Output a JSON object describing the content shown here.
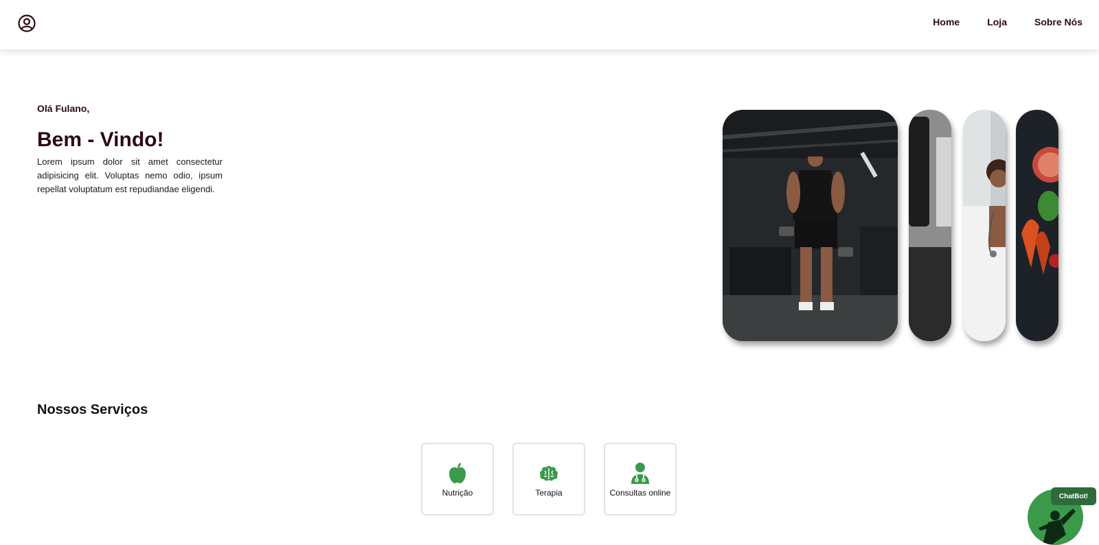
{
  "nav": {
    "user_icon": "user-circle-icon",
    "links": [
      "Home",
      "Loja",
      "Sobre Nós"
    ]
  },
  "hero": {
    "greeting": "Olá Fulano,",
    "title": "Bem - Vindo!",
    "text": "Lorem ipsum dolor sit amet consectetur adipisicing elit. Voluptas nemo odio, ipsum repellat voluptatum est repudiandae eligendi."
  },
  "gallery": {
    "images": [
      "gym-bodybuilder-photo",
      "punching-bag-photo",
      "doctor-photo",
      "vegetables-photo"
    ]
  },
  "services": {
    "title": "Nossos Serviços",
    "items": [
      {
        "label": "Nutrição",
        "icon": "apple-icon"
      },
      {
        "label": "Terapia",
        "icon": "brain-icon"
      },
      {
        "label": "Consultas online",
        "icon": "doctor-icon"
      }
    ],
    "accent": "#3a9a4a"
  },
  "chatbot": {
    "label": "ChatBot!"
  },
  "colors": {
    "text_dark": "#2c0a10",
    "green": "#3a9a4a",
    "badge": "#2e6b3a"
  }
}
